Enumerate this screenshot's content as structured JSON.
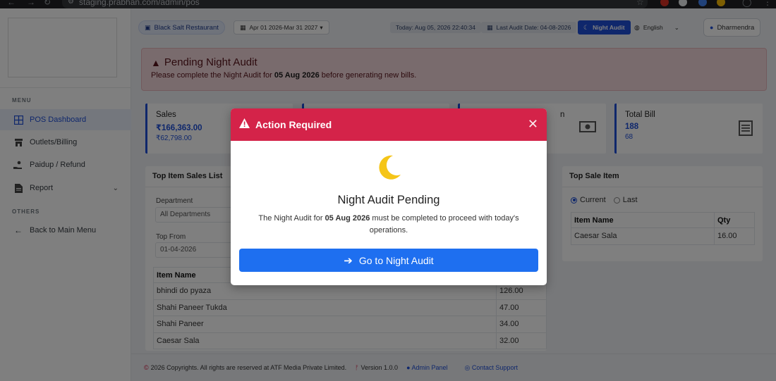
{
  "browser": {
    "url": "staging.prabhan.com/admin/pos"
  },
  "sidebar": {
    "menu_heading": "MENU",
    "others_heading": "OTHERS",
    "items": [
      {
        "label": "POS Dashboard",
        "icon": "grid-icon",
        "active": true
      },
      {
        "label": "Outlets/Billing",
        "icon": "store-icon"
      },
      {
        "label": "Paidup / Refund",
        "icon": "hand-money-icon"
      },
      {
        "label": "Report",
        "icon": "document-icon"
      }
    ],
    "back_label": "Back to Main Menu"
  },
  "topbar": {
    "outlet": "Black Salt Restaurant",
    "date_range": "Apr 01 2026-Mar 31 2027",
    "today": "Today: Aug 05, 2026 22:40:34",
    "last_audit": "Last Audit Date: 04-08-2026",
    "night_audit_btn": "Night Audit",
    "language": "English",
    "user": "Dharmendra"
  },
  "alert": {
    "title": "Pending Night Audit",
    "text_pre": "Please complete the Night Audit for",
    "date": "05 Aug 2026",
    "text_post": "before generating new bills."
  },
  "stats": {
    "sales": {
      "label": "Sales",
      "value": "₹166,363.00",
      "sub": "₹62,798.00"
    },
    "partial_label_tail": "n",
    "total_bill": {
      "label": "Total Bill",
      "value": "188",
      "sub": "68"
    }
  },
  "top_items": {
    "title": "Top Item Sales List",
    "department_label": "Department",
    "department_value": "All Departments",
    "top_from_label": "Top From",
    "top_from_value": "01-04-2026",
    "col_item": "Item Name",
    "rows": [
      {
        "name": "bhindi do pyaza",
        "qty": "126.00"
      },
      {
        "name": "Shahi Paneer Tukda",
        "qty": "47.00"
      },
      {
        "name": "Shahi Paneer",
        "qty": "34.00"
      },
      {
        "name": "Caesar Sala",
        "qty": "32.00"
      }
    ]
  },
  "top_sale": {
    "title": "Top Sale Item",
    "radio_current": "Current",
    "radio_last": "Last",
    "col_item": "Item Name",
    "col_qty": "Qty",
    "rows": [
      {
        "name": "Caesar Sala",
        "qty": "16.00"
      }
    ]
  },
  "footer": {
    "copyright": "2026 Copyrights. All rights are reserved at ATF Media Private Limited.",
    "version": "Version 1.0.0",
    "admin": "Admin Panel",
    "support": "Contact Support"
  },
  "modal": {
    "header": "Action Required",
    "title": "Night Audit Pending",
    "desc_pre": "The Night Audit for",
    "desc_date": "05 Aug 2026",
    "desc_post": "must be completed to proceed with today's operations.",
    "button": "Go to Night Audit"
  },
  "colors": {
    "primary": "#1e4fd8",
    "danger_header": "#d42349",
    "moon": "#f5c518",
    "button": "#1e6ff0"
  }
}
